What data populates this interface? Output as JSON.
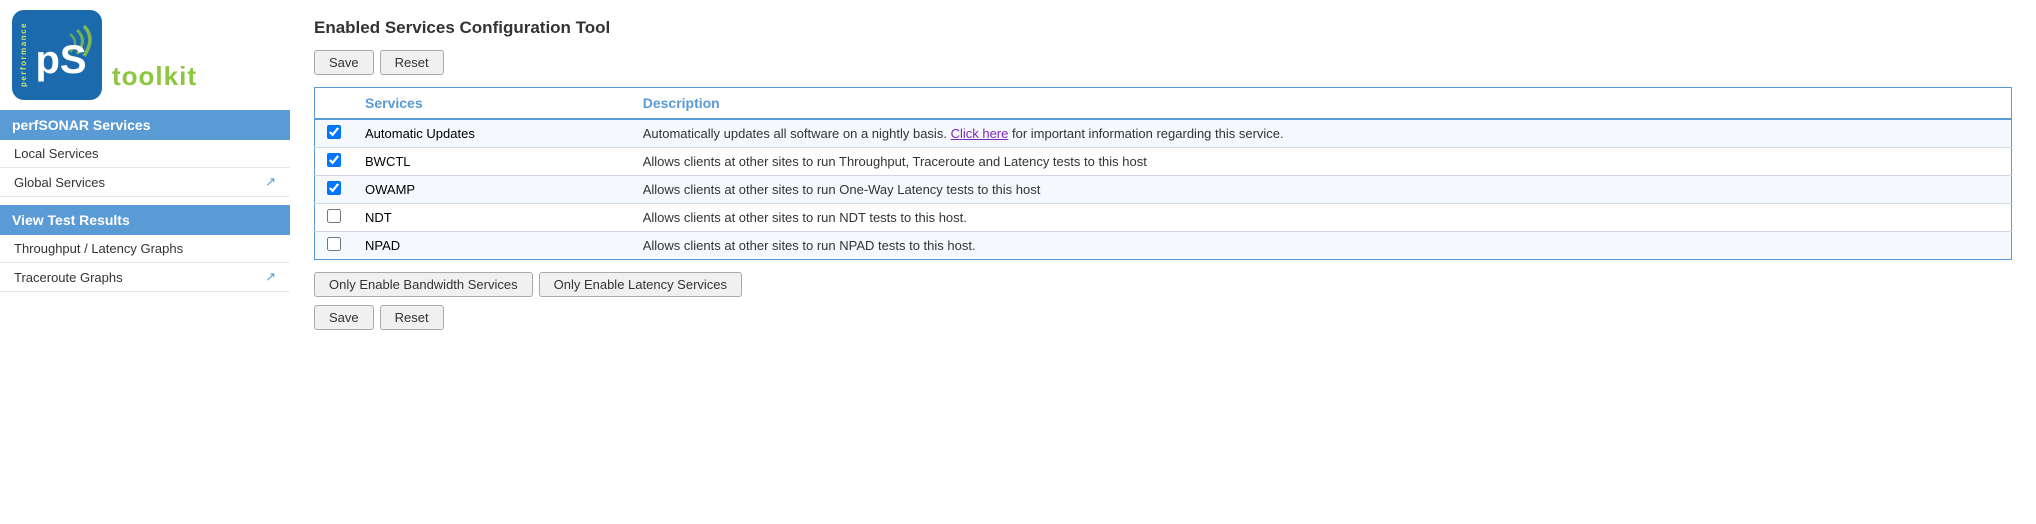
{
  "sidebar": {
    "logo": {
      "ps_label": "pS",
      "performance_label": "performance",
      "toolkit_label": "toolkit"
    },
    "perfsonar_section": {
      "header": "perfSONAR Services",
      "items": [
        {
          "label": "Local Services",
          "ext": false,
          "name": "local-services"
        },
        {
          "label": "Global Services",
          "ext": true,
          "name": "global-services"
        }
      ]
    },
    "view_results_section": {
      "header": "View Test Results",
      "items": [
        {
          "label": "Throughput / Latency Graphs",
          "ext": false,
          "name": "throughput-latency"
        },
        {
          "label": "Traceroute Graphs",
          "ext": true,
          "name": "traceroute"
        }
      ]
    }
  },
  "main": {
    "page_title": "Enabled Services Configuration Tool",
    "top_buttons": {
      "save": "Save",
      "reset": "Reset"
    },
    "table": {
      "headers": [
        "Services",
        "Description"
      ],
      "rows": [
        {
          "checked": true,
          "service": "Automatic Updates",
          "description_prefix": "Automatically updates all software on a nightly basis. ",
          "link_text": "Click here",
          "description_suffix": " for important information regarding this service."
        },
        {
          "checked": true,
          "service": "BWCTL",
          "description_prefix": "Allows clients at other sites to run Throughput, Traceroute and Latency tests to this host",
          "link_text": "",
          "description_suffix": ""
        },
        {
          "checked": true,
          "service": "OWAMP",
          "description_prefix": "Allows clients at other sites to run One-Way Latency tests to this host",
          "link_text": "",
          "description_suffix": ""
        },
        {
          "checked": false,
          "service": "NDT",
          "description_prefix": "Allows clients at other sites to run NDT tests to this host.",
          "link_text": "",
          "description_suffix": ""
        },
        {
          "checked": false,
          "service": "NPAD",
          "description_prefix": "Allows clients at other sites to run NPAD tests to this host.",
          "link_text": "",
          "description_suffix": ""
        }
      ]
    },
    "bottom_buttons": {
      "bandwidth": "Only Enable Bandwidth Services",
      "latency": "Only Enable Latency Services",
      "save": "Save",
      "reset": "Reset"
    }
  }
}
